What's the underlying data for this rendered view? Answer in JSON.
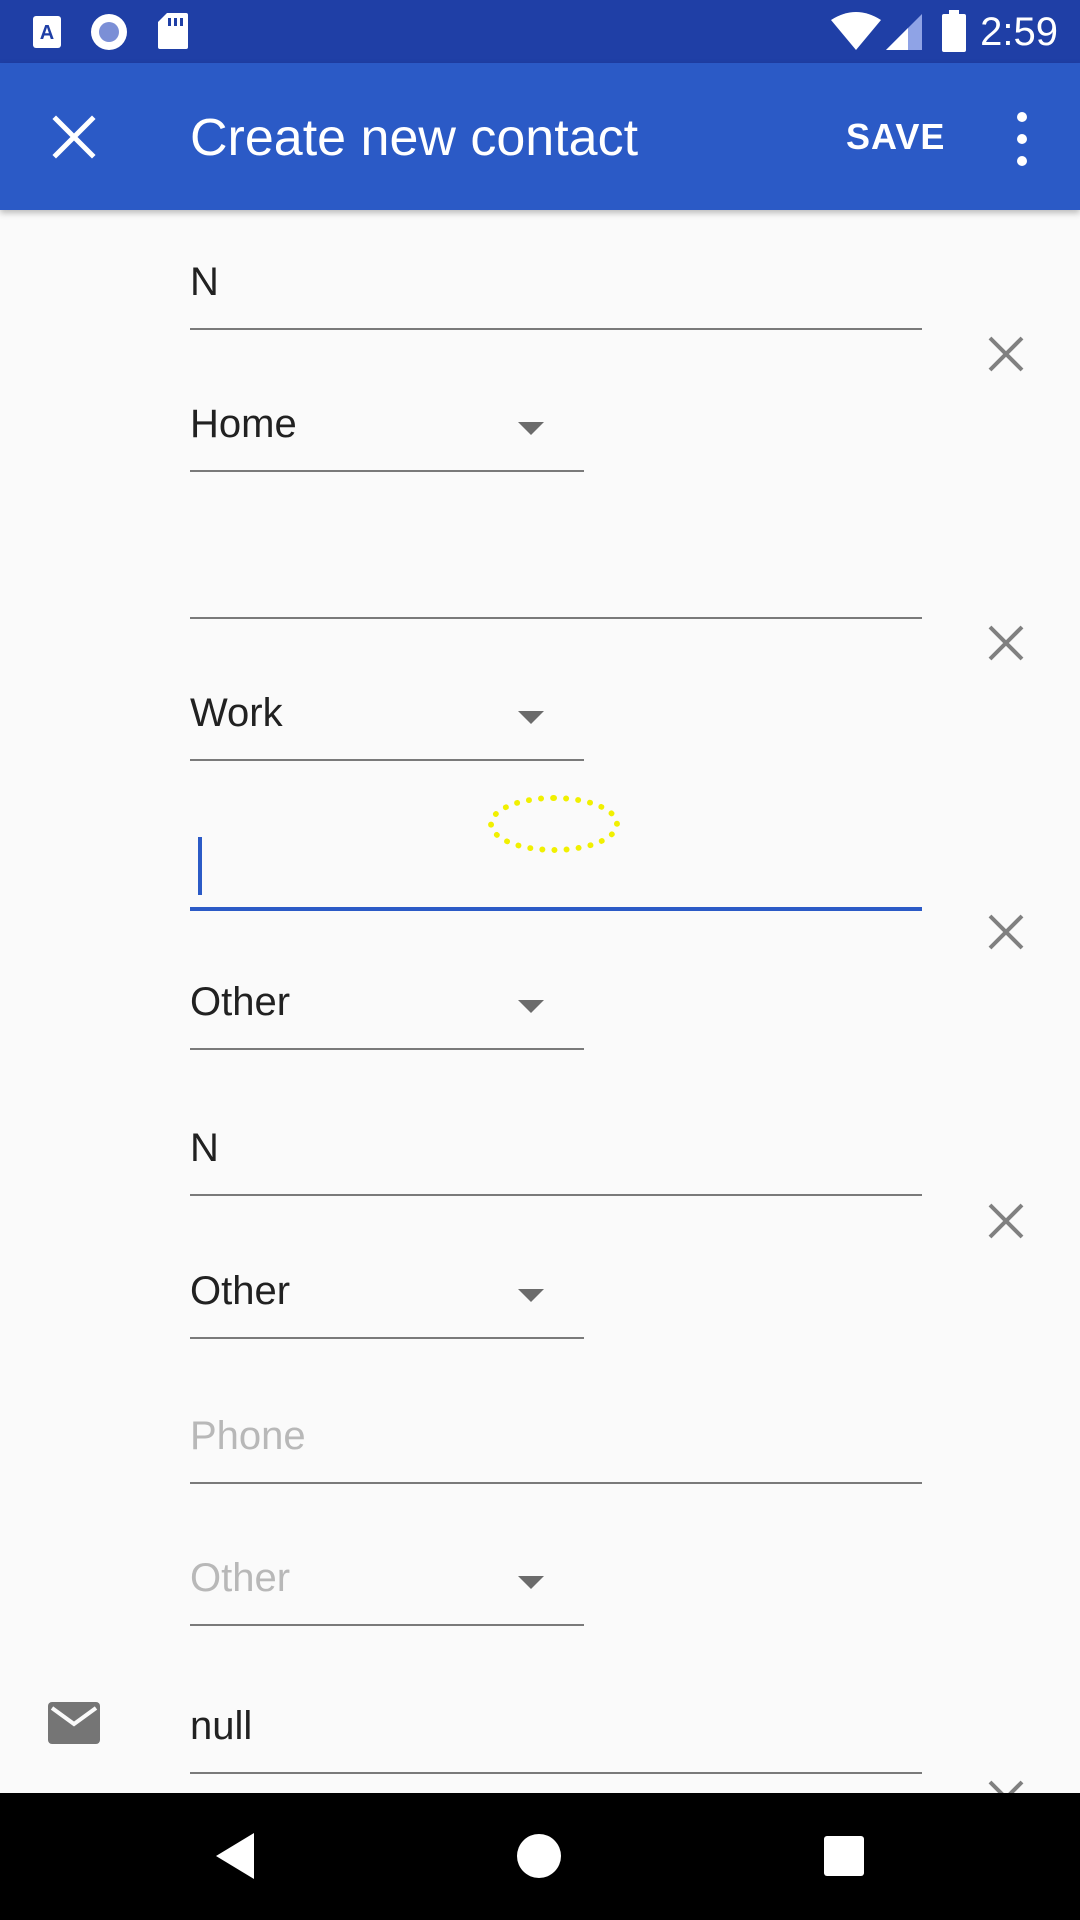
{
  "status_bar": {
    "time": "2:59",
    "icons": [
      "a11y-font-icon",
      "circle-record-icon",
      "sd-card-icon",
      "wifi-icon",
      "signal-icon",
      "battery-icon"
    ]
  },
  "app_bar": {
    "title": "Create new contact",
    "save_label": "SAVE",
    "close_icon": "close-icon",
    "more_icon": "more-vert-icon",
    "color": "#2b5ac6"
  },
  "phone_entries": [
    {
      "value": "N",
      "type": "Home"
    },
    {
      "value": "",
      "type": "Work"
    },
    {
      "value": "",
      "type": "Other",
      "focused": true
    },
    {
      "value": "N",
      "type": "Other"
    },
    {
      "placeholder": "Phone",
      "type": "Other"
    }
  ],
  "email_entry": {
    "value": "null"
  },
  "colors": {
    "accent": "#2b5ac6",
    "status_bar": "#1f3fa6",
    "touch_indicator": "#f1f000"
  },
  "nav_bar": {
    "icons": [
      "back-icon",
      "home-icon",
      "recents-icon"
    ]
  }
}
